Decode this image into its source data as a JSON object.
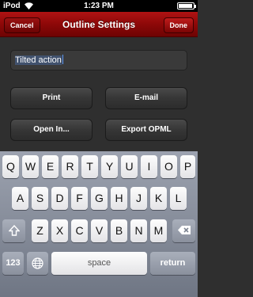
{
  "status_bar": {
    "carrier": "iPod",
    "time": "1:23 PM"
  },
  "nav": {
    "title": "Outline Settings",
    "cancel": "Cancel",
    "done": "Done"
  },
  "field": {
    "value": "Tilted action"
  },
  "actions": {
    "print": "Print",
    "email": "E-mail",
    "open_in": "Open In...",
    "export_opml": "Export OPML"
  },
  "keyboard": {
    "row1": [
      "Q",
      "W",
      "E",
      "R",
      "T",
      "Y",
      "U",
      "I",
      "O",
      "P"
    ],
    "row2": [
      "A",
      "S",
      "D",
      "F",
      "G",
      "H",
      "J",
      "K",
      "L"
    ],
    "row3": [
      "Z",
      "X",
      "C",
      "V",
      "B",
      "N",
      "M"
    ],
    "numbers": "123",
    "space": "space",
    "return": "return",
    "icons": {
      "shift": "shift-icon",
      "delete": "delete-icon",
      "globe": "globe-icon"
    }
  }
}
